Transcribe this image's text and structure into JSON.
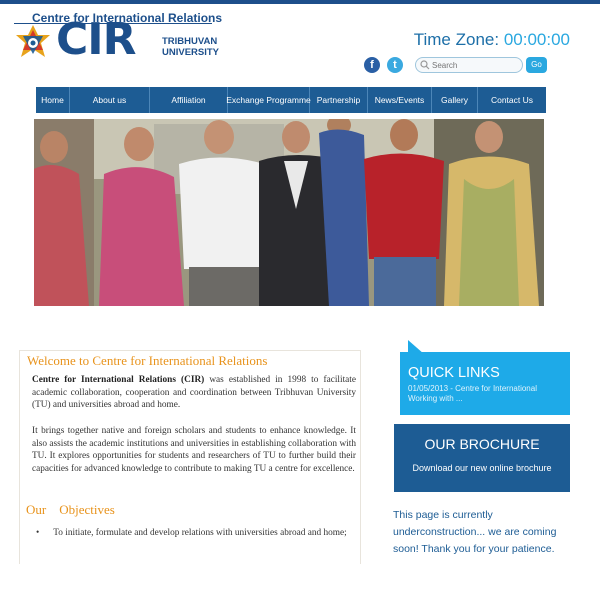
{
  "header": {
    "centre_name": "Centre for International Relations",
    "acronym": "CIR",
    "university_line1": "TRIBHUVAN",
    "university_line2": "UNIVERSITY",
    "timezone_label": "Time Zone:",
    "timezone_value": "00:00:00"
  },
  "social": {
    "facebook_glyph": "f",
    "twitter_glyph": "t"
  },
  "search": {
    "placeholder": "Search",
    "go_label": "Go"
  },
  "nav": {
    "items": [
      "Home",
      "About us",
      "Affiliation",
      "Exchange Programme",
      "Partnership",
      "News/Events",
      "Gallery",
      "Contact Us"
    ]
  },
  "welcome": {
    "title": "Welcome to Centre for International Relations",
    "p1_bold": "Centre for International Relations (CIR)",
    "p1_rest": " was established in 1998 to facilitate academic collaboration, cooperation and coordination between Tribhuvan University (TU) and universities abroad and home.",
    "p2": "It brings together native and foreign scholars and students to enhance knowledge. It also assists the academic institutions and universities in establishing collaboration with TU. It explores opportunities for students and researchers of TU to further build their capacities for advanced knowledge to contribute to making TU a centre for excellence.",
    "objectives_title": "Our    Objectives",
    "objective1": "To initiate, formulate and develop relations with universities abroad and home;"
  },
  "quick_links": {
    "title": "QUICK LINKS",
    "news_line": "01/05/2013 - Centre for International Working with ..."
  },
  "brochure": {
    "title": "OUR BROCHURE",
    "download": "Download our new online brochure"
  },
  "notice": "This page is currently underconstruction... we are coming soon! Thank you for your patience.",
  "colors": {
    "brand_blue": "#1d5c94",
    "accent_orange": "#e8931c",
    "sky_blue": "#1eaae8"
  }
}
